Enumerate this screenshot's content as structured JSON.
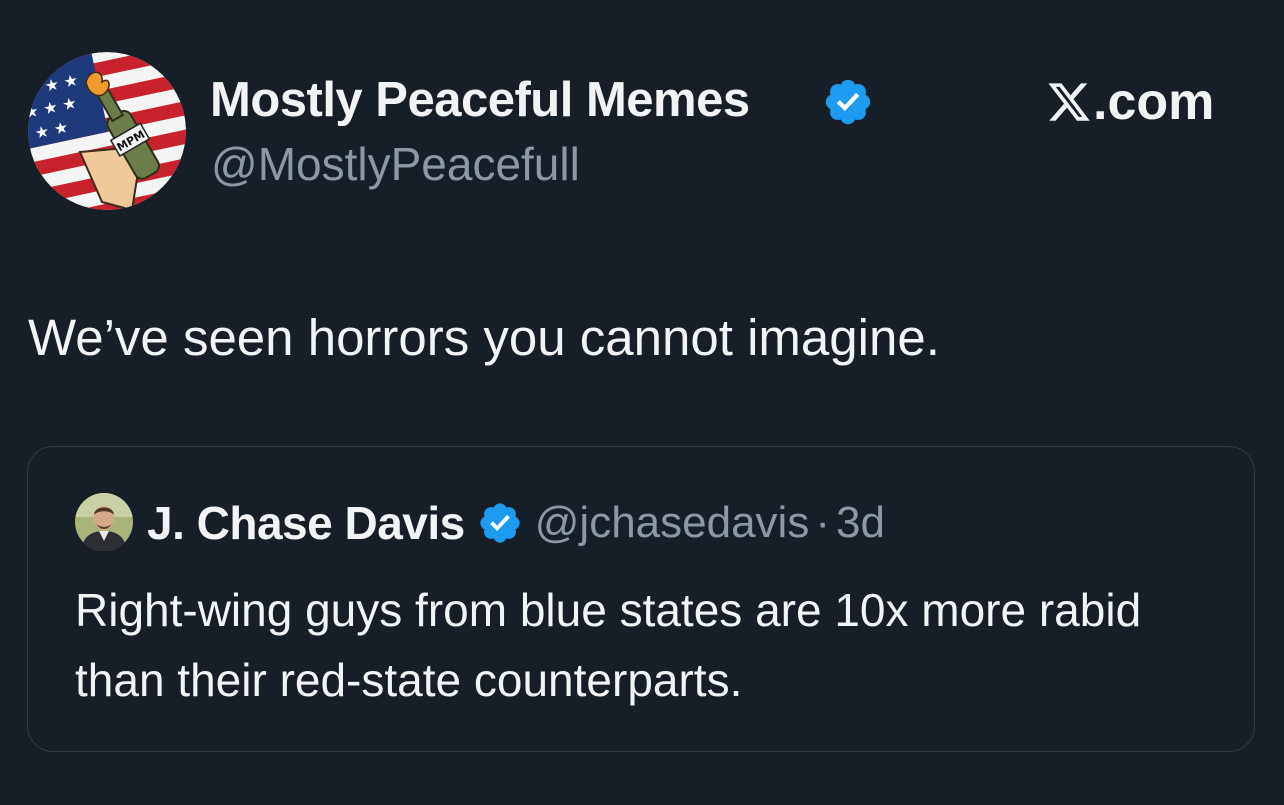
{
  "tweet": {
    "display_name": "Mostly Peaceful Memes",
    "handle": "@MostlyPeacefull",
    "verified": true,
    "brand_suffix": ".com",
    "text": "We’ve seen horrors you cannot imagine.",
    "avatar": {
      "icon": "flag-molotov-avatar",
      "badge_text": "MPM"
    }
  },
  "quoted_tweet": {
    "display_name": "J. Chase Davis",
    "handle": "@jchasedavis",
    "separator": "·",
    "timestamp": "3d",
    "verified": true,
    "text": "Right-wing guys from blue states are 10x more rabid than their red-state counterparts.",
    "avatar": {
      "icon": "profile-photo-avatar"
    }
  },
  "colors": {
    "background": "#161e28",
    "text_primary": "#f2f3f4",
    "text_secondary": "#8b98a5",
    "verified_blue": "#1d9bf0",
    "card_border": "#323c47"
  }
}
